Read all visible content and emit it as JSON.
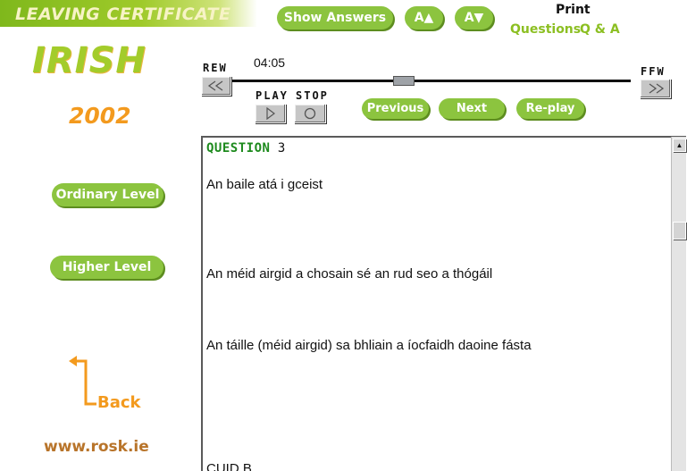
{
  "header": {
    "banner_title": "LEAVING CERTIFICATE",
    "show_answers_label": "Show Answers",
    "font_increase_label": "A▲",
    "font_decrease_label": "A▼",
    "print_label": "Print",
    "print_questions_label": "Questions",
    "print_qa_label": "Q & A"
  },
  "sidebar": {
    "subject": "IRISH",
    "year": "2002",
    "ordinary_level_label": "Ordinary Level",
    "higher_level_label": "Higher Level",
    "back_label": "Back",
    "website": "www.rosk.ie"
  },
  "player": {
    "rew_label": "REW",
    "ffw_label": "FFW",
    "play_label": "PLAY",
    "stop_label": "STOP",
    "time": "04:05",
    "previous_label": "Previous",
    "next_label": "Next",
    "replay_label": "Re-play"
  },
  "content": {
    "question_word": "QUESTION",
    "question_number": "3",
    "lines": [
      "An baile atá i gceist",
      "An méid airgid a chosain sé an rud seo a thógáil",
      "An táille (méid airgid)  sa bhliain a íocfaidh daoine fásta",
      "CUID B"
    ]
  },
  "colors": {
    "accent_green": "#8cc43f",
    "orange": "#f39a1e",
    "question_green": "#1d8a1d"
  }
}
